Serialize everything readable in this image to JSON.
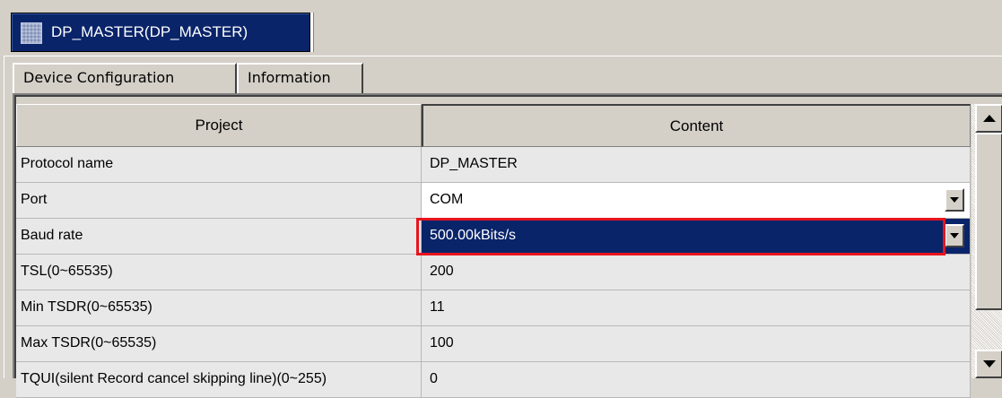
{
  "document_tab": {
    "icon": "grid-module-icon",
    "label": "DP_MASTER(DP_MASTER)"
  },
  "page_tabs": [
    {
      "label": "Device Configuration",
      "active": true
    },
    {
      "label": "Information",
      "active": false
    }
  ],
  "grid": {
    "columns": [
      "Project",
      "Content"
    ],
    "rows": [
      {
        "name": "Protocol name",
        "value": "DP_MASTER",
        "editor": "text"
      },
      {
        "name": "Port",
        "value": "COM",
        "editor": "dropdown"
      },
      {
        "name": "Baud rate",
        "value": "500.00kBits/s",
        "editor": "dropdown",
        "selected": true,
        "highlighted": true
      },
      {
        "name": "TSL(0~65535)",
        "value": "200",
        "editor": "text"
      },
      {
        "name": "Min TSDR(0~65535)",
        "value": "11",
        "editor": "text"
      },
      {
        "name": "Max TSDR(0~65535)",
        "value": "100",
        "editor": "text"
      },
      {
        "name": "TQUI(silent Record cancel skipping line)(0~255)",
        "value": "0",
        "editor": "text"
      }
    ]
  },
  "colors": {
    "selection": "#0a246a",
    "highlight_border": "#e8141e",
    "chrome": "#d4d0c8"
  }
}
